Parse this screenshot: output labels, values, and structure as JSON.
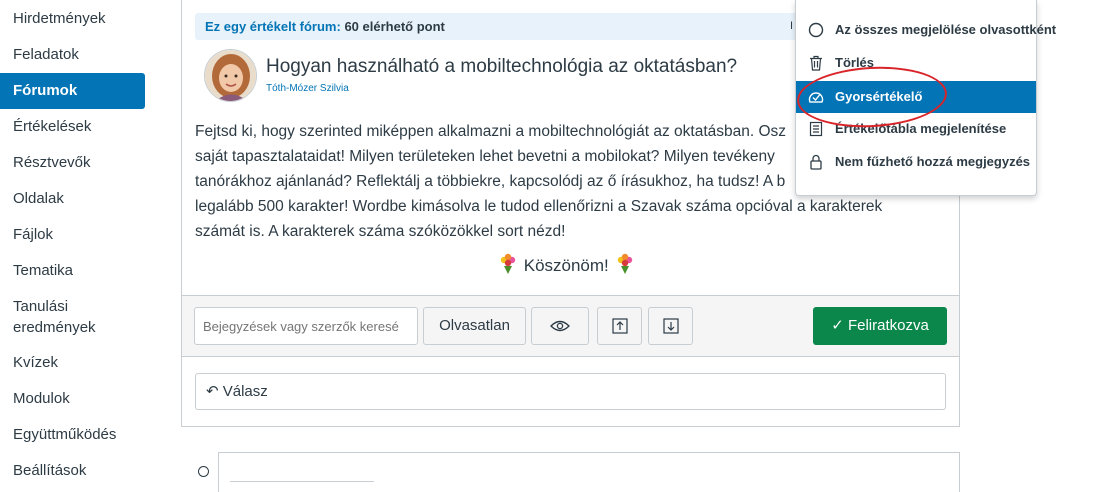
{
  "sidebar": {
    "items": [
      {
        "label": "Hirdetmények"
      },
      {
        "label": "Feladatok"
      },
      {
        "label": "Fórumok",
        "active": true
      },
      {
        "label": "Értékelések"
      },
      {
        "label": "Résztvevők"
      },
      {
        "label": "Oldalak"
      },
      {
        "label": "Fájlok"
      },
      {
        "label": "Tematika"
      },
      {
        "label": "Tanulási eredmények"
      },
      {
        "label": "Kvízek"
      },
      {
        "label": "Modulok"
      },
      {
        "label": "Együttműködés"
      },
      {
        "label": "Beállítások"
      }
    ]
  },
  "banner": {
    "graded_label": "Ez egy értékelt fórum:",
    "points": "60 elérhető pont",
    "trailing": "I"
  },
  "post": {
    "title": "Hogyan használható a mobiltechnológia az oktatásban?",
    "author": "Tóth-Mózer Szilvia",
    "body_lines": [
      "Fejtsd ki, hogy szerinted miképpen alkalmazni a mobiltechnológiát az oktatásban. Osz",
      "saját tapasztalataidat! Milyen területeken lehet bevetni a mobilokat? Milyen tevékeny",
      "tanórákhoz ajánlanád? Reflektálj a többiekre, kapcsolódj az ő írásukhoz, ha tudsz! A b",
      "legalább 500 karakter! Wordbe kimásolva le tudod ellenőrizni a Szavak száma opcióval a karakterek",
      "számát is. A karakterek száma szóközökkel sort nézd!"
    ],
    "thanks": "Köszönöm!"
  },
  "toolbar": {
    "search_placeholder": "Bejegyzések vagy szerzők keresé",
    "unread_label": "Olvasatlan",
    "subscribe_label": "Feliratkozva"
  },
  "reply": {
    "label": "Válasz"
  },
  "menu": {
    "items": [
      {
        "label": "Az összes megjelölése olvasottként",
        "icon": "circle-icon"
      },
      {
        "label": "Törlés",
        "icon": "trash-icon"
      },
      {
        "label": "Gyorsértékelő",
        "icon": "speedgrader-icon",
        "selected": true
      },
      {
        "label": "Értékelőtábla megjelenítése",
        "icon": "rubric-icon"
      },
      {
        "label": "Nem fűzhető hozzá megjegyzés",
        "icon": "lock-icon"
      }
    ]
  },
  "colors": {
    "primary": "#0374B5",
    "success": "#0B874B",
    "annotation": "#d9252a",
    "text": "#2d3b45"
  }
}
